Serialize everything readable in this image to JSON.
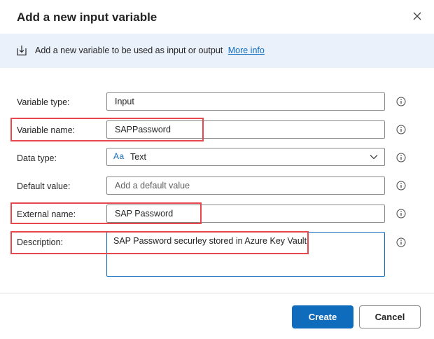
{
  "dialog": {
    "title": "Add a new input variable"
  },
  "info_bar": {
    "text": "Add a new variable to be used as input or output",
    "link": "More info"
  },
  "form": {
    "variable_type": {
      "label": "Variable type:",
      "value": "Input"
    },
    "variable_name": {
      "label": "Variable name:",
      "value": "SAPPassword"
    },
    "data_type": {
      "label": "Data type:",
      "icon_text": "Aa",
      "value": "Text"
    },
    "default_value": {
      "label": "Default value:",
      "placeholder": "Add a default value"
    },
    "external_name": {
      "label": "External name:",
      "value": "SAP Password"
    },
    "description": {
      "label": "Description:",
      "value": "SAP Password securley stored in Azure Key Vault"
    }
  },
  "buttons": {
    "create": "Create",
    "cancel": "Cancel"
  },
  "icons": {
    "close": "close-icon",
    "info_bar": "import-variable-icon",
    "info": "info-icon",
    "dropdown": "chevron-down-icon"
  },
  "colors": {
    "accent": "#0f6cbd",
    "info_bar_bg": "#eaf1fb",
    "highlight": "#e8474d"
  }
}
